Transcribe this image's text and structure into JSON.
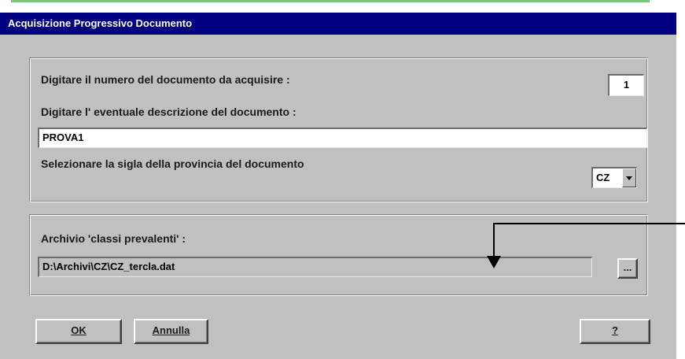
{
  "window": {
    "title": "Acquisizione Progressivo Documento"
  },
  "documento": {
    "numero_label": "Digitare il numero del documento da acquisire :",
    "numero_value": "1",
    "descrizione_label": "Digitare l' eventuale descrizione del documento :",
    "descrizione_value": "PROVA1",
    "provincia_label": "Selezionare la sigla della provincia del documento",
    "provincia_value": "CZ"
  },
  "archivio": {
    "label": "Archivio 'classi prevalenti' :",
    "path_value": "D:\\Archivi\\CZ\\CZ_tercla.dat",
    "browse_label": "..."
  },
  "buttons": {
    "ok_label": "OK",
    "annulla_label": "Annulla",
    "help_label": "?"
  },
  "colors": {
    "titlebar": "#000080",
    "dialog_bg": "#c0c0c0",
    "top_accent": "#79c87a"
  }
}
